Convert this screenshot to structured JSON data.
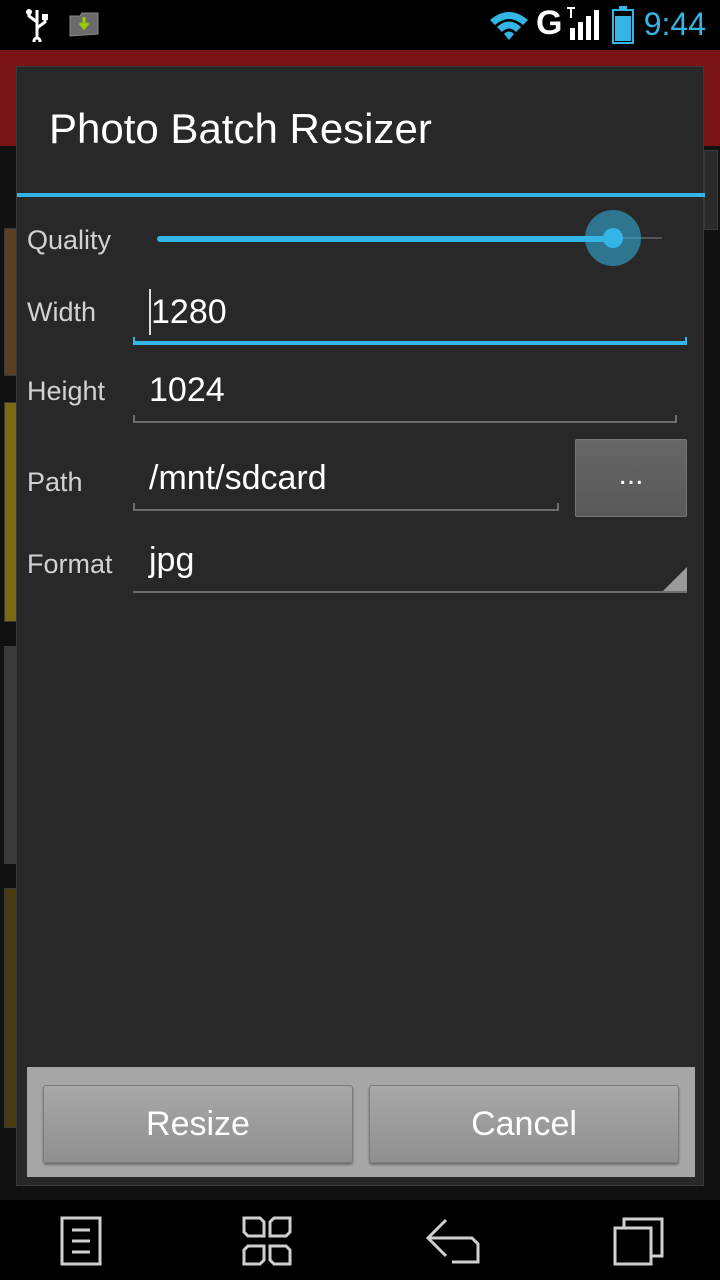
{
  "status_bar": {
    "time": "9:44",
    "network_type": "G",
    "icons": [
      "usb-icon",
      "download-notification-icon",
      "wifi-icon",
      "signal-icon",
      "battery-icon"
    ]
  },
  "dialog": {
    "title": "Photo Batch Resizer",
    "quality": {
      "label": "Quality",
      "value_fraction": 0.902
    },
    "width": {
      "label": "Width",
      "value": "1280"
    },
    "height": {
      "label": "Height",
      "value": "1024"
    },
    "path": {
      "label": "Path",
      "value": "/mnt/sdcard",
      "browse_label": "..."
    },
    "format": {
      "label": "Format",
      "selected": "jpg"
    },
    "buttons": {
      "resize": "Resize",
      "cancel": "Cancel"
    }
  },
  "nav_bar": {
    "icons": [
      "menu-icon",
      "home-icon",
      "back-icon",
      "recent-apps-icon"
    ]
  },
  "colors": {
    "accent": "#33b5e5",
    "dialog_bg": "#282828",
    "background_header": "#7a1414"
  }
}
